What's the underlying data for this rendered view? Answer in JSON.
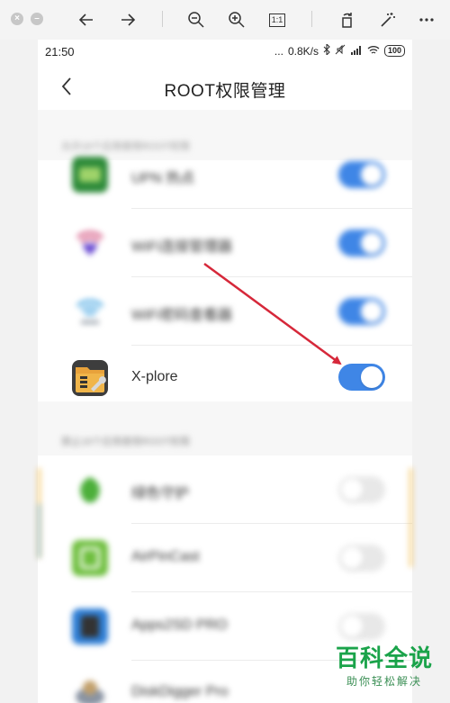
{
  "viewer": {
    "icons": [
      "close-window-icon",
      "minimize-window-icon",
      "arrow-left-icon",
      "arrow-right-icon",
      "zoom-out-icon",
      "zoom-in-icon",
      "actual-size-icon",
      "rotate-icon",
      "magic-wand-icon",
      "more-icon"
    ],
    "actual_size_label": "1:1"
  },
  "status_bar": {
    "time": "21:50",
    "dots": "...",
    "speed": "0.8K/s",
    "battery": "100"
  },
  "header": {
    "title": "ROOT权限管理"
  },
  "allowed_section": {
    "label": "允许16个应用使用ROOT权限",
    "apps": [
      {
        "name": "UPN 热点",
        "icon": "green-app-icon",
        "enabled": true
      },
      {
        "name": "WiFi连接管理器",
        "icon": "wifi-heart-icon",
        "enabled": true
      },
      {
        "name": "WiFi密码查看器",
        "icon": "wifi-icon",
        "enabled": true
      },
      {
        "name": "X-plore",
        "icon": "x-plore-icon",
        "enabled": true
      }
    ]
  },
  "denied_section": {
    "label": "禁止16个应用使用ROOT权限",
    "apps": [
      {
        "name": "绿色守护",
        "icon": "green-leaf-icon",
        "enabled": false
      },
      {
        "name": "AirPinCast",
        "icon": "airpincast-icon",
        "enabled": false
      },
      {
        "name": "Apps2SD PRO",
        "icon": "apps2sd-icon",
        "enabled": false
      },
      {
        "name": "DiskDigger Pro",
        "icon": "diskdigger-icon",
        "enabled": false
      }
    ]
  },
  "watermark": {
    "title": "百科全说",
    "subtitle": "助你轻松解决"
  },
  "colors": {
    "toggle_on": "#3f86e6",
    "toggle_off": "#e8e8e8",
    "annotation_arrow": "#d6283a",
    "watermark_green": "#1aa34a"
  }
}
